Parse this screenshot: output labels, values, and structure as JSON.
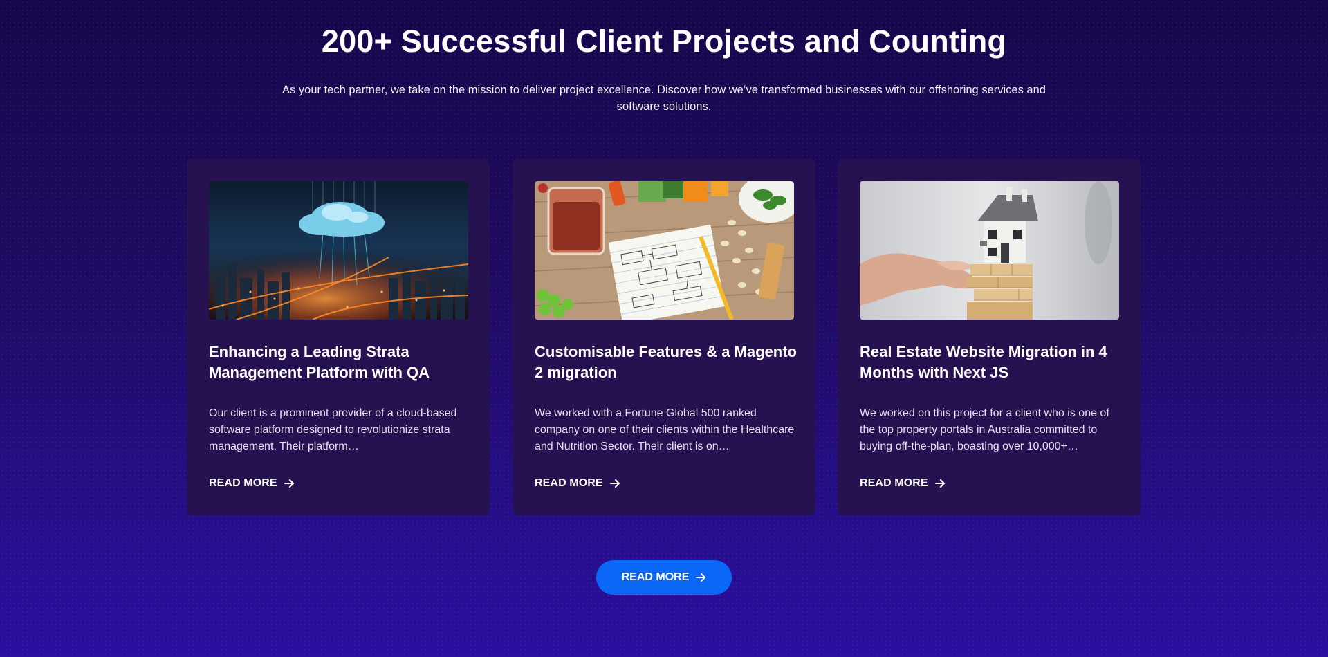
{
  "section": {
    "title": "200+ Successful Client Projects and Counting",
    "subtitle": "As your tech partner, we take on the mission to deliver project excellence. Discover how we’ve transformed businesses with our offshoring services and software solutions."
  },
  "cards": [
    {
      "image_icon": "cloud-city-image",
      "title": "Enhancing a Leading Strata Management Platform with QA",
      "description": "Our client is a prominent provider of a cloud-based software platform designed to revolutionize strata management. Their platform…",
      "link_label": "READ MORE"
    },
    {
      "image_icon": "food-notes-image",
      "title": "Customisable Features & a Magento 2 migration",
      "description": "We worked with a Fortune Global 500 ranked company on one of their clients within the Healthcare and Nutrition Sector. Their client is on…",
      "link_label": "READ MORE"
    },
    {
      "image_icon": "house-blocks-image",
      "title": "Real Estate Website Migration in 4 Months with Next JS",
      "description": "We worked on this project for a client who is one of the top property portals in Australia committed to buying off-the-plan, boasting over 10,000+…",
      "link_label": "READ MORE"
    }
  ],
  "main_button": {
    "label": "READ MORE",
    "icon": "arrow-right-icon"
  },
  "colors": {
    "background_top": "#17064a",
    "background_bottom": "#2a0fa0",
    "card_background": "#261251",
    "button": "#0b67f5",
    "text": "#ffffff"
  }
}
